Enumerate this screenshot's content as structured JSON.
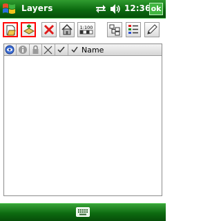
{
  "titlebar": {
    "title": "Layers",
    "time": "12:36",
    "ok_label": "ok",
    "start_icon": "windows-flag-icon",
    "connectivity_icon": "connectivity-icon",
    "volume_icon": "speaker-icon"
  },
  "toolbar": {
    "buttons": [
      {
        "name": "open-layer-button",
        "icon": "open-folder-icon",
        "selected": true
      },
      {
        "name": "add-layer-button",
        "icon": "add-layer-icon",
        "selected": true
      },
      {
        "name": "remove-layer-button",
        "icon": "red-x-icon",
        "selected": false
      },
      {
        "name": "properties-button",
        "icon": "house-icon",
        "selected": false
      },
      {
        "name": "scale-button",
        "icon": "scale-icon",
        "label": "1:100",
        "selected": false
      },
      {
        "name": "layer-tree-button",
        "icon": "tree-icon",
        "selected": false
      },
      {
        "name": "layer-list-button",
        "icon": "list-icon",
        "selected": false
      },
      {
        "name": "edit-button",
        "icon": "pencil-icon",
        "selected": false
      }
    ]
  },
  "list": {
    "columns": [
      {
        "name": "visible-column",
        "icon": "eye-icon"
      },
      {
        "name": "info-column",
        "icon": "info-icon"
      },
      {
        "name": "lock-column",
        "icon": "lock-icon"
      },
      {
        "name": "edit-column",
        "icon": "pen-crossed-icon"
      },
      {
        "name": "check-column",
        "icon": "checkmark-icon"
      },
      {
        "name": "name-column",
        "icon": "checkmark-icon",
        "label": "Name"
      }
    ],
    "rows": []
  },
  "bottombar": {
    "keyboard_icon": "keyboard-icon"
  }
}
